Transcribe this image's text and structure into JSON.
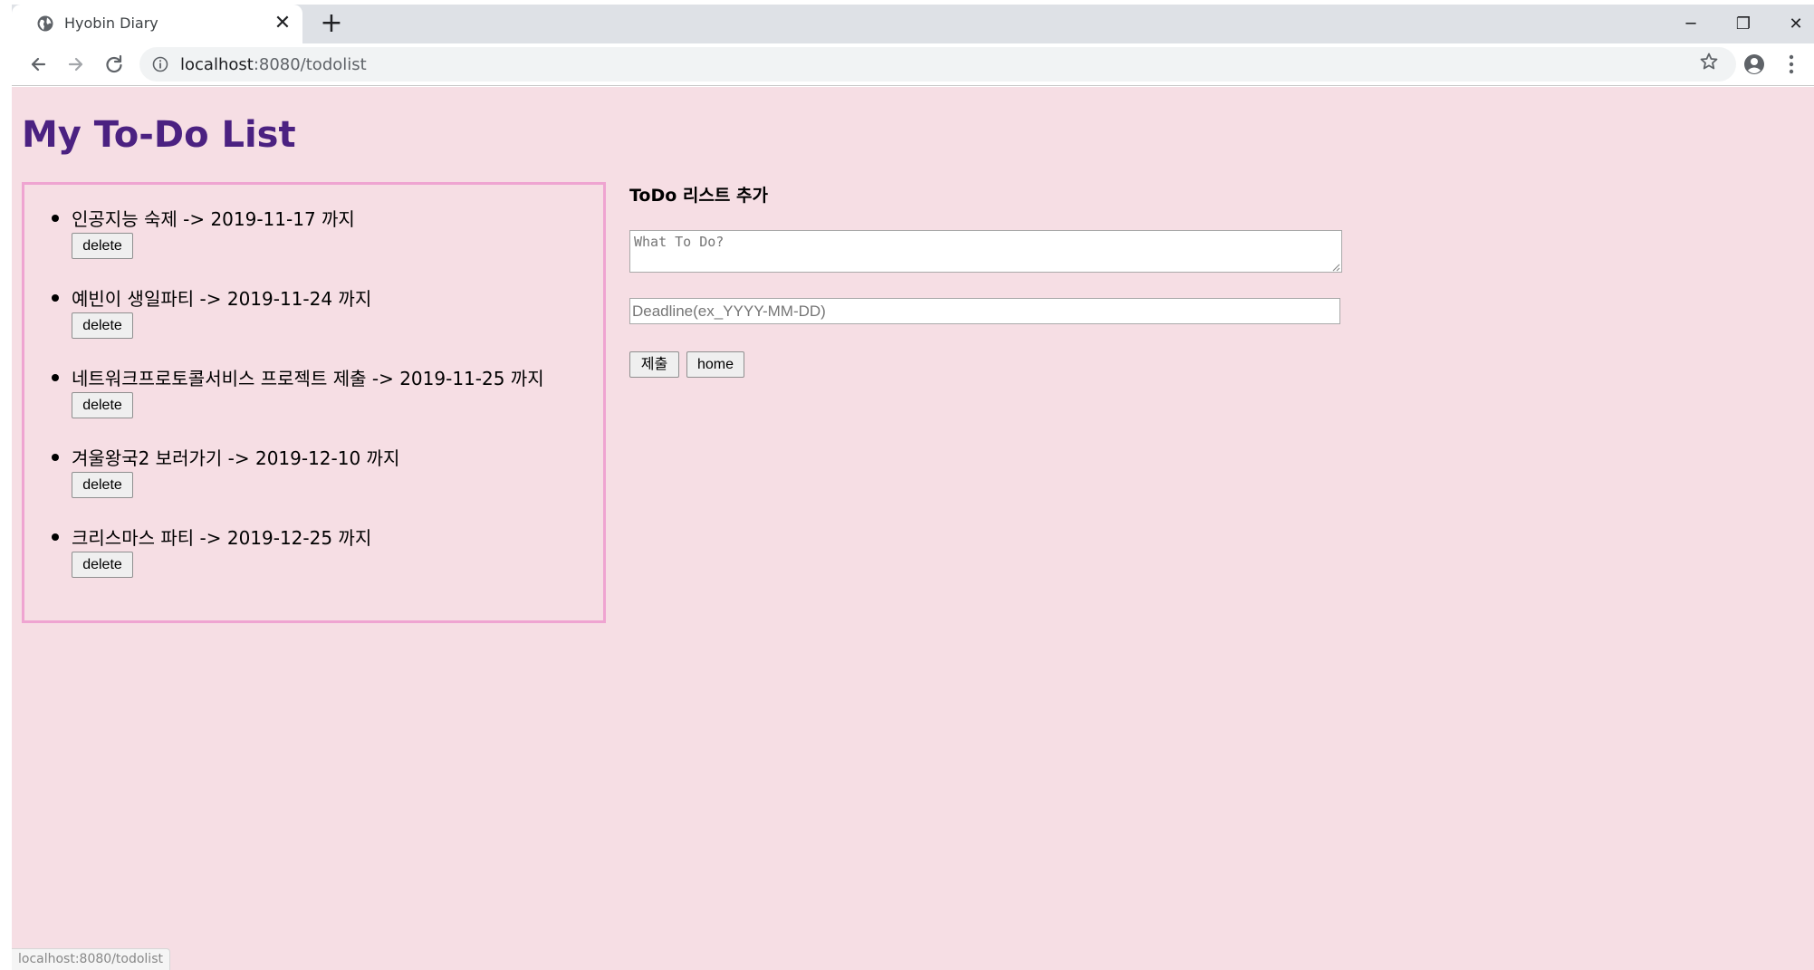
{
  "browser": {
    "tab_title": "Hyobin Diary",
    "tab_close_glyph": "✕",
    "new_tab_glyph": "+",
    "url_host": "localhost",
    "url_rest": ":8080/todolist",
    "window_controls": {
      "minimize": "─",
      "restore": "❐",
      "close": "✕"
    },
    "icons": [
      "globe-icon",
      "back-icon",
      "forward-icon",
      "reload-icon",
      "info-icon",
      "star-icon",
      "account-icon",
      "menu-icon"
    ]
  },
  "page": {
    "title": "My To-Do List",
    "background": "#f6dee4",
    "title_color": "#4b2181",
    "border_color": "#efa4d1"
  },
  "todos": [
    {
      "text": "인공지능 숙제 -> 2019-11-17 까지",
      "button": "delete"
    },
    {
      "text": "예빈이 생일파티 -> 2019-11-24 까지",
      "button": "delete"
    },
    {
      "text": "네트워크프로토콜서비스 프로젝트 제출 -> 2019-11-25 까지",
      "button": "delete"
    },
    {
      "text": "겨울왕국2 보러가기 -> 2019-12-10 까지",
      "button": "delete"
    },
    {
      "text": "크리스마스 파티 -> 2019-12-25 까지",
      "button": "delete"
    }
  ],
  "form": {
    "heading": "ToDo 리스트 추가",
    "what_placeholder": "What To Do?",
    "deadline_placeholder": "Deadline(ex_YYYY-MM-DD)",
    "submit_label": "제출",
    "home_label": "home"
  },
  "status_bar": {
    "text": "localhost:8080/todolist"
  }
}
